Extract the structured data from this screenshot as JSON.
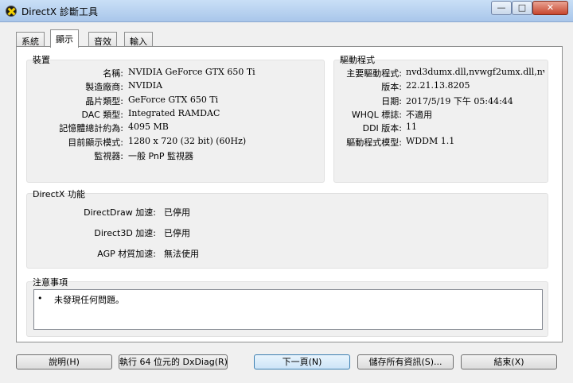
{
  "window": {
    "title": "DirectX 診斷工具",
    "minimize": "—",
    "maximize": "□",
    "close": "✕"
  },
  "tabs": [
    {
      "label": "系統"
    },
    {
      "label": "顯示"
    },
    {
      "label": "音效"
    },
    {
      "label": "輸入"
    }
  ],
  "device": {
    "title": "裝置",
    "rows": [
      {
        "label": "名稱:",
        "value": "NVIDIA GeForce GTX 650 Ti"
      },
      {
        "label": "製造廠商:",
        "value": "NVIDIA"
      },
      {
        "label": "晶片類型:",
        "value": "GeForce GTX 650 Ti"
      },
      {
        "label": "DAC 類型:",
        "value": "Integrated RAMDAC"
      },
      {
        "label": "記憶體總計約為:",
        "value": "4095 MB"
      },
      {
        "label": "目前顯示模式:",
        "value": "1280 x 720 (32 bit) (60Hz)"
      },
      {
        "label": "監視器:",
        "value": "一般 PnP 監視器"
      }
    ]
  },
  "driver": {
    "title": "驅動程式",
    "rows": [
      {
        "label": "主要驅動程式:",
        "value": "nvd3dumx.dll,nvwgf2umx.dll,nvwgf2"
      },
      {
        "label": "版本:",
        "value": "22.21.13.8205"
      },
      {
        "label": "日期:",
        "value": "2017/5/19 下午 05:44:44"
      },
      {
        "label": "WHQL 標誌:",
        "value": "不適用"
      },
      {
        "label": "DDI 版本:",
        "value": "11"
      },
      {
        "label": "驅動程式模型:",
        "value": "WDDM 1.1"
      }
    ]
  },
  "directx_features": {
    "title": "DirectX 功能",
    "rows": [
      {
        "label": "DirectDraw 加速:",
        "value": "已停用"
      },
      {
        "label": "Direct3D 加速:",
        "value": "已停用"
      },
      {
        "label": "AGP 材質加速:",
        "value": "無法使用"
      }
    ]
  },
  "notes": {
    "title": "注意事項",
    "bullet": "•",
    "items": [
      "未發現任何問題。"
    ]
  },
  "buttons": {
    "help": "說明(H)",
    "run64": "執行 64 位元的 DxDiag(R)",
    "next": "下一頁(N)",
    "save_all": "儲存所有資訊(S)...",
    "exit": "結束(X)"
  }
}
